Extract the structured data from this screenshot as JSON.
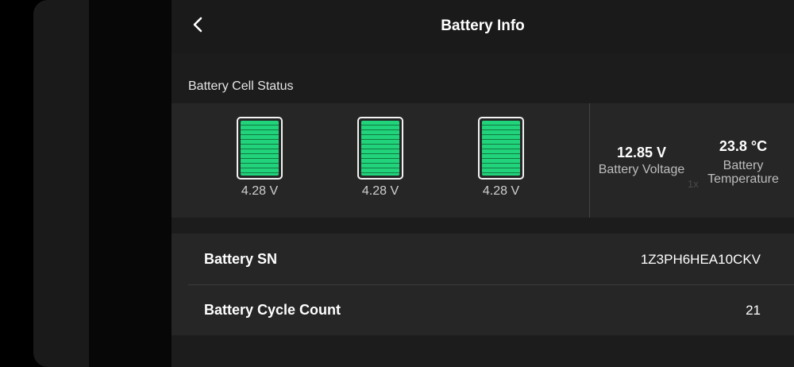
{
  "header": {
    "title": "Battery Info",
    "back_icon": "chevron-left-icon"
  },
  "cell_status": {
    "section_label": "Battery Cell Status",
    "cells": [
      {
        "voltage": "4.28 V"
      },
      {
        "voltage": "4.28 V"
      },
      {
        "voltage": "4.28 V"
      }
    ],
    "cell_fill_color": "#21d37a",
    "voltage": {
      "value": "12.85 V",
      "label": "Battery Voltage"
    },
    "temperature": {
      "value": "23.8 °C",
      "label": "Battery Temperature"
    },
    "ghost_text": "1x"
  },
  "info": {
    "rows": [
      {
        "label": "Battery SN",
        "value": "1Z3PH6HEA10CKV"
      },
      {
        "label": "Battery Cycle Count",
        "value": "21"
      }
    ]
  }
}
